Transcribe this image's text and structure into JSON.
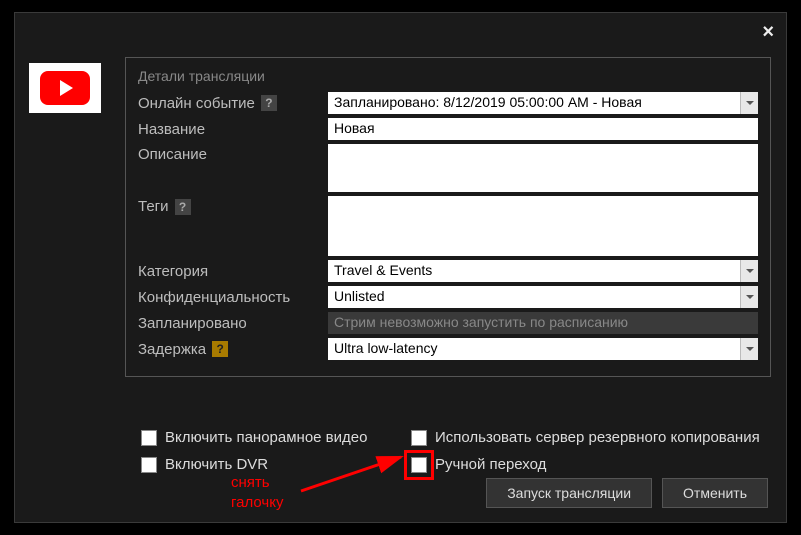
{
  "close_label": "×",
  "panel": {
    "title": "Детали трансляции",
    "rows": {
      "online_event": {
        "label": "Онлайн событие",
        "value": "Запланировано: 8/12/2019 05:00:00 AM - Новая"
      },
      "name": {
        "label": "Название",
        "value": "Новая"
      },
      "description": {
        "label": "Описание",
        "value": ""
      },
      "tags": {
        "label": "Теги",
        "value": ""
      },
      "category": {
        "label": "Категория",
        "value": "Travel & Events"
      },
      "privacy": {
        "label": "Конфиденциальность",
        "value": "Unlisted"
      },
      "scheduled": {
        "label": "Запланировано",
        "value": "Стрим невозможно запустить по расписанию"
      },
      "latency": {
        "label": "Задержка",
        "value": "Ultra low-latency"
      }
    }
  },
  "checkboxes": {
    "panoramic": "Включить панорамное видео",
    "backup": "Использовать сервер резервного копирования",
    "dvr": "Включить DVR",
    "manual": "Ручной переход"
  },
  "buttons": {
    "start": "Запуск трансляции",
    "cancel": "Отменить"
  },
  "annotation": {
    "line1": "снять",
    "line2": "галочку"
  },
  "help_glyph": "?"
}
